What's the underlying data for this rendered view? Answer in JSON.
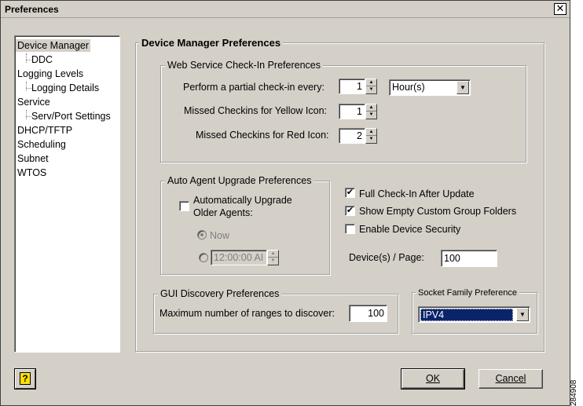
{
  "window": {
    "title": "Preferences",
    "close_glyph": "✕"
  },
  "tree": {
    "items": [
      {
        "label": "Device Manager",
        "level": 0,
        "selected": true
      },
      {
        "label": "DDC",
        "level": 1
      },
      {
        "label": "Logging Levels",
        "level": 0
      },
      {
        "label": "Logging Details",
        "level": 1
      },
      {
        "label": "Service",
        "level": 0
      },
      {
        "label": "Serv/Port Settings",
        "level": 1
      },
      {
        "label": "DHCP/TFTP",
        "level": 0
      },
      {
        "label": "Scheduling",
        "level": 0
      },
      {
        "label": "Subnet",
        "level": 0
      },
      {
        "label": "WTOS",
        "level": 0
      }
    ]
  },
  "main": {
    "title": "Device Manager Preferences"
  },
  "web_service": {
    "title": "Web Service Check-In Preferences",
    "partial_label": "Perform a partial check-in every:",
    "partial_value": "1",
    "unit_value": "Hour(s)",
    "yellow_label": "Missed Checkins for Yellow Icon:",
    "yellow_value": "1",
    "red_label": "Missed Checkins for Red Icon:",
    "red_value": "2"
  },
  "auto_upgrade": {
    "title": "Auto Agent Upgrade Preferences",
    "checkbox_label_line1": "Automatically Upgrade",
    "checkbox_label_line2": "Older Agents:",
    "checked": false,
    "now_label": "Now",
    "time_value": "12:00:00 AI"
  },
  "options": {
    "full_checkin_label": "Full Check-In After Update",
    "full_checkin_checked": true,
    "show_empty_label": "Show Empty Custom Group Folders",
    "show_empty_checked": true,
    "device_security_label": "Enable Device Security",
    "device_security_checked": false,
    "devices_page_label": "Device(s) / Page:",
    "devices_page_value": "100"
  },
  "gui_discovery": {
    "title": "GUI Discovery Preferences",
    "max_ranges_label": "Maximum number of ranges to discover:",
    "max_ranges_value": "100"
  },
  "socket": {
    "title": "Socket Family Preference",
    "value": "IPV4"
  },
  "buttons": {
    "ok_label": "OK",
    "cancel_label": "Cancel",
    "help_glyph": "?"
  },
  "figure_id": "284908",
  "glyphs": {
    "check": "✔",
    "dropdown": "▼",
    "spin_up": "▲",
    "spin_down": "▼"
  }
}
